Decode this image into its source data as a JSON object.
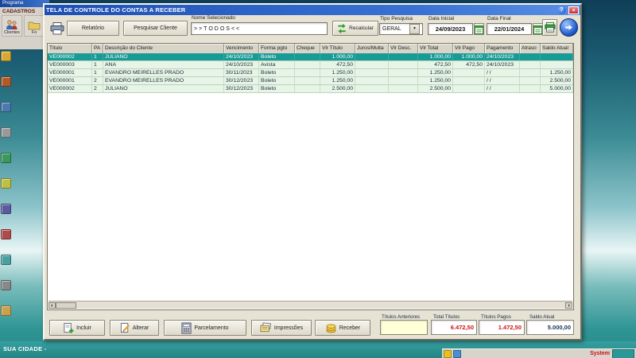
{
  "background": {
    "app_title": "Programa",
    "menu_label": "CADASTROS",
    "toolbar_buttons": [
      {
        "label": "Clientes"
      },
      {
        "label": "Fo"
      }
    ],
    "status_text": "SUA CIDADE -",
    "taskbar_item": "System"
  },
  "icons": {
    "help": "?",
    "close": "×",
    "dropdown": "▼"
  },
  "dialog": {
    "title": "TELA DE CONTROLE DO CONTAS A RECEBER",
    "toolbar": {
      "relatorio": "Relatório",
      "pesquisar_cliente": "Pesquisar Cliente",
      "nome_selecionado_label": "Nome Selecionado",
      "nome_selecionado_value": ">>TODOS<<",
      "recalcular": "Recalcular",
      "tipo_pesquisa_label": "Tipo Pesquisa",
      "tipo_pesquisa_value": "GERAL",
      "data_inicial_label": "Data Inicial",
      "data_inicial_value": "24/09/2023",
      "data_final_label": "Data Final",
      "data_final_value": "22/01/2024"
    },
    "grid": {
      "columns": [
        "Título",
        "PA",
        "Descrição do Cliente",
        "Vencimento",
        "Forma pgto",
        "Cheque",
        "Vlr Título",
        "Juros/Multa",
        "Vlr Desc.",
        "Vlr Total",
        "Vlr Pago",
        "Pagamento",
        "Atraso",
        "Saldo Atual"
      ],
      "selected_index": 0,
      "rows": [
        [
          "VE000002",
          "1",
          "JULIANO",
          "24/10/2023",
          "Boleto",
          "",
          "1.000,00",
          "",
          "",
          "1.000,00",
          "1.000,00",
          "24/10/2023",
          "",
          ""
        ],
        [
          "VE000003",
          "1",
          "ANA",
          "24/10/2023",
          "Avista",
          "",
          "472,50",
          "",
          "",
          "472,50",
          "472,50",
          "24/10/2023",
          "",
          ""
        ],
        [
          "VE000001",
          "1",
          "EVANDRO MEIRELLES PRADO",
          "30/11/2023",
          "Boleto",
          "",
          "1.250,00",
          "",
          "",
          "1.250,00",
          "",
          "/ /",
          "",
          "1.250,00"
        ],
        [
          "VE000001",
          "2",
          "EVANDRO MEIRELLES PRADO",
          "30/12/2023",
          "Boleto",
          "",
          "1.250,00",
          "",
          "",
          "1.250,00",
          "",
          "/ /",
          "",
          "2.500,00"
        ],
        [
          "VE000002",
          "2",
          "JULIANO",
          "30/12/2023",
          "Boleto",
          "",
          "2.500,00",
          "",
          "",
          "2.500,00",
          "",
          "/ /",
          "",
          "5.000,00"
        ]
      ]
    },
    "actions": [
      {
        "label": "Incluir"
      },
      {
        "label": "Alterar"
      },
      {
        "label": "Parcelamento"
      },
      {
        "label": "Impressões"
      },
      {
        "label": "Receber"
      }
    ],
    "totals": [
      {
        "label": "Títulos Anteriores",
        "value": ""
      },
      {
        "label": "Total Títulos",
        "value": "6.472,50"
      },
      {
        "label": "Títulos Pagos",
        "value": "1.472,50"
      },
      {
        "label": "Saldo Atual",
        "value": "5.000,00"
      }
    ]
  }
}
